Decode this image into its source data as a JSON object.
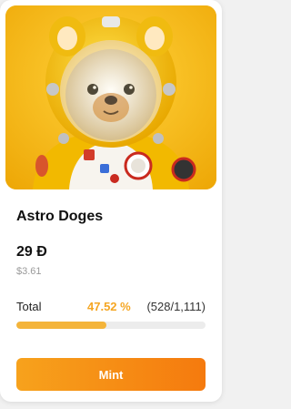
{
  "card": {
    "title": "Astro Doges",
    "price": "29 Đ",
    "price_usd": "$3.61",
    "progress": {
      "label": "Total",
      "percent_text": "47.52 %",
      "percent_value": 47.52,
      "count_text": "(528/1,111)"
    },
    "mint_label": "Mint"
  },
  "colors": {
    "accent": "#f5a623",
    "button_start": "#f7a21c",
    "button_end": "#f57a0e",
    "image_bg": "#f3b510"
  }
}
